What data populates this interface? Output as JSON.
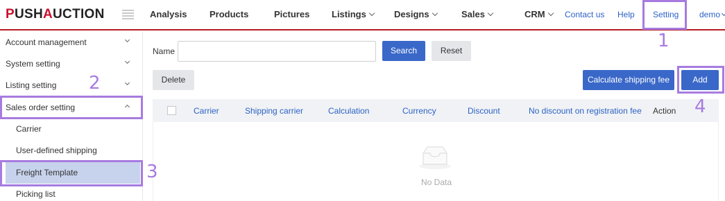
{
  "header": {
    "logo_prefix": "P",
    "logo_mid": "USH",
    "logo_a": "A",
    "logo_rest": "UCTION",
    "nav": [
      "Analysis",
      "Products",
      "Pictures",
      "Listings",
      "Designs",
      "Sales",
      "CRM"
    ],
    "links": [
      "Contact us",
      "Help",
      "Setting",
      "demo"
    ]
  },
  "sidebar": {
    "groups": [
      "Account management",
      "System setting",
      "Listing setting",
      "Sales order setting"
    ],
    "sub_items": [
      "Carrier",
      "User-defined shipping",
      "Freight Template",
      "Picking list"
    ]
  },
  "search": {
    "name_label": "Name",
    "name_value": "",
    "search_label": "Search",
    "reset_label": "Reset"
  },
  "toolbar": {
    "delete_label": "Delete",
    "calc_label": "Calculate shipping fee",
    "add_label": "Add"
  },
  "table": {
    "columns": [
      "Carrier",
      "Shipping carrier",
      "Calculation",
      "Currency",
      "Discount",
      "No discount on registration fee",
      "Action"
    ],
    "empty_text": "No Data"
  },
  "annotations": [
    "1",
    "2",
    "3",
    "4"
  ],
  "colors": {
    "accent": "#3a68c9",
    "brand_red": "#c8102e",
    "header_line": "#b51d24",
    "highlight": "#a77be0",
    "active_row": "#c7d3ec"
  }
}
